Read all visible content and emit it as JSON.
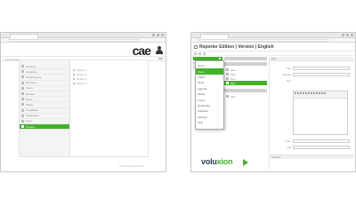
{
  "left_window": {
    "brand_logo": "cae",
    "subheader_title": "Administration",
    "sidebar_items": [
      {
        "label": "General",
        "active": false
      },
      {
        "label": "Locations",
        "active": false
      },
      {
        "label": "Departments",
        "active": false
      },
      {
        "label": "Services",
        "active": false
      },
      {
        "label": "Users",
        "active": false
      },
      {
        "label": "Groups",
        "active": false
      },
      {
        "label": "Roles",
        "active": false
      },
      {
        "label": "Rights",
        "active": false
      },
      {
        "label": "Templates",
        "active": false
      },
      {
        "label": "Languages",
        "active": false
      },
      {
        "label": "Logs",
        "active": false
      },
      {
        "label": "Options",
        "active": true
      }
    ],
    "content_lines": [
      "Option 1",
      "Option 2",
      "Option 3",
      "Option 4"
    ],
    "footer_text": "Powered by voluxion"
  },
  "right_window": {
    "title": "Reporter Edition | Version | English",
    "dropdown_items": [
      {
        "label": "Home",
        "active": false
      },
      {
        "label": "Users",
        "active": true
      },
      {
        "label": "Pages",
        "active": false
      },
      {
        "label": "News",
        "active": false
      },
      {
        "label": "Agenda",
        "active": false
      },
      {
        "label": "Media",
        "active": false
      },
      {
        "label": "Forms",
        "active": false
      },
      {
        "label": "Newsletter",
        "active": false
      },
      {
        "label": "Statistics",
        "active": false
      },
      {
        "label": "Settings",
        "active": false
      },
      {
        "label": "Help",
        "active": false
      }
    ],
    "tree_items": [
      {
        "label": "Item",
        "active": false
      },
      {
        "label": "Item",
        "active": false
      },
      {
        "label": "Item",
        "active": false
      },
      {
        "label": "Item",
        "active": true
      }
    ],
    "tree_extra": "Item",
    "panel_header": "Edit",
    "form_labels": [
      "Title",
      "Subtitle",
      "Text",
      "Date",
      "Link"
    ],
    "panel_band": "Options",
    "brand_logo_main": "volu",
    "brand_logo_accent": "xion"
  },
  "colors": {
    "accent": "#43b02a",
    "brand_dark": "#2c3d55"
  }
}
